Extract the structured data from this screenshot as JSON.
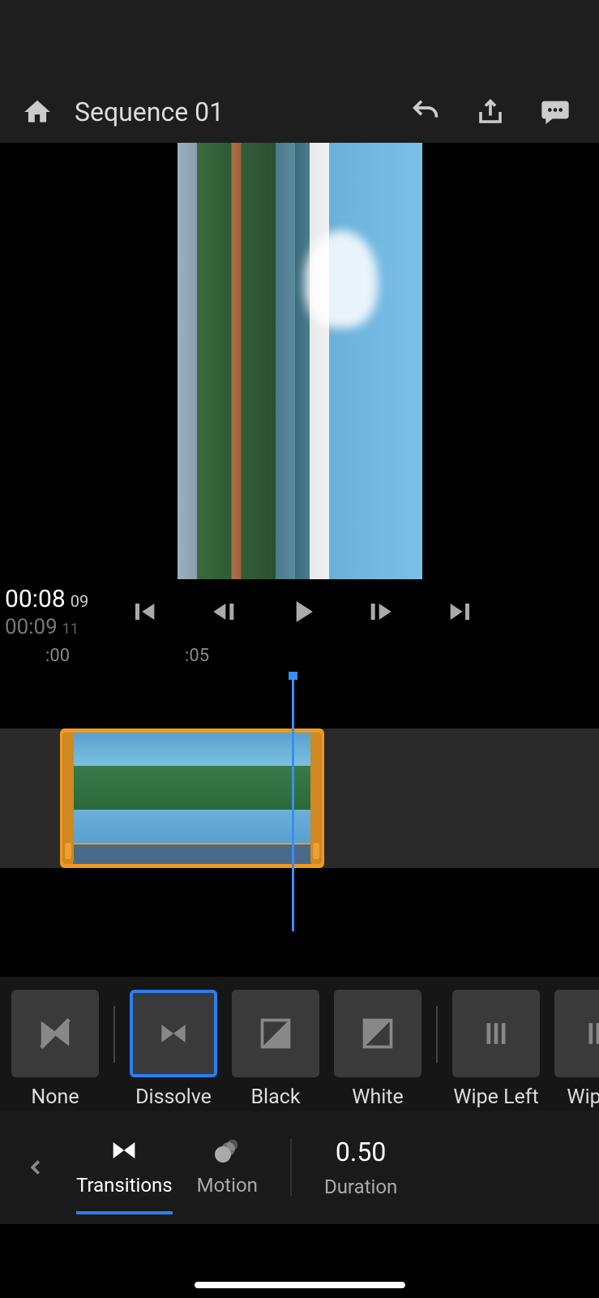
{
  "header": {
    "title": "Sequence 01"
  },
  "playback": {
    "current_time": "00:08",
    "current_frames": "09",
    "total_time": "00:09",
    "total_frames": "11"
  },
  "ruler": {
    "mark0": ":00",
    "mark5": ":05"
  },
  "transitions": {
    "items": [
      {
        "label": "None"
      },
      {
        "label": "Dissolve"
      },
      {
        "label": "Black"
      },
      {
        "label": "White"
      },
      {
        "label": "Wipe Left"
      },
      {
        "label": "Wipe R"
      }
    ],
    "selected_index": 1
  },
  "tabs": {
    "transitions_label": "Transitions",
    "motion_label": "Motion",
    "duration_label": "Duration",
    "duration_value": "0.50"
  },
  "colors": {
    "accent": "#2a7ef0",
    "clip_selected": "#f09820"
  }
}
